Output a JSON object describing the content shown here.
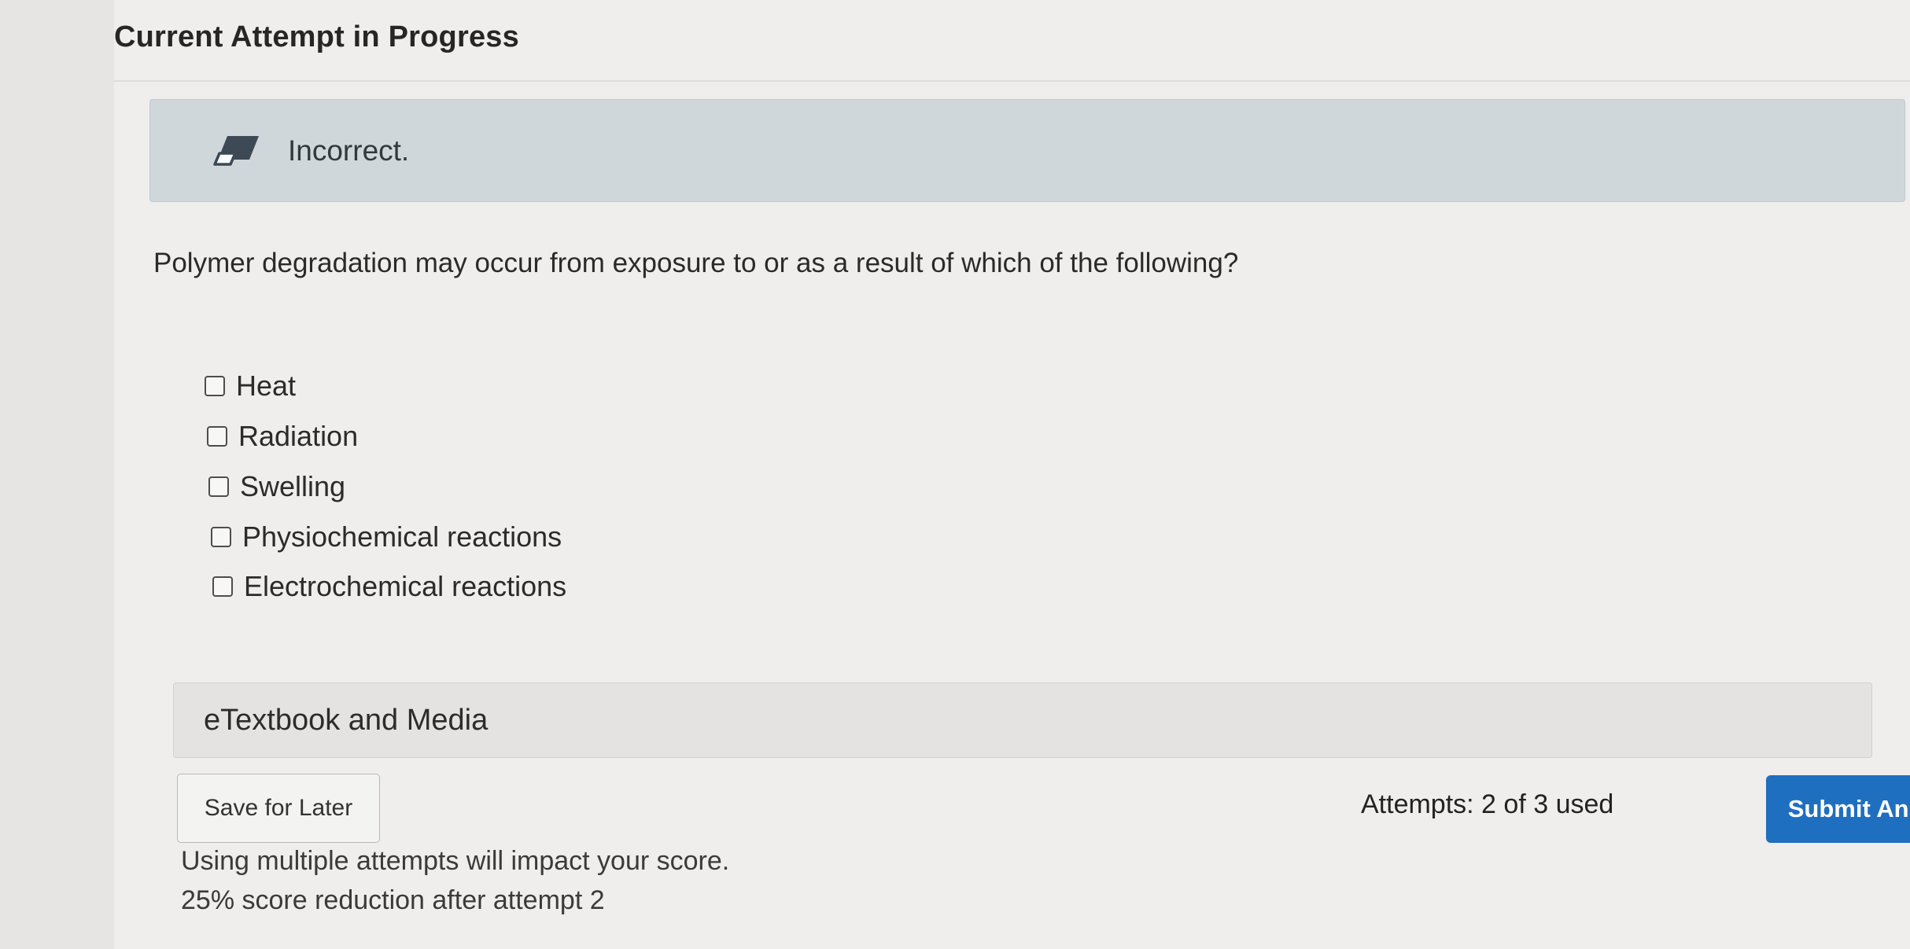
{
  "header": {
    "title": "Current Attempt in Progress"
  },
  "feedback": {
    "icon": "eraser-icon",
    "message": "Incorrect."
  },
  "question": {
    "text": "Polymer degradation may occur from exposure to or as a result of which of the following?",
    "options": [
      {
        "label": "Heat",
        "checked": false
      },
      {
        "label": "Radiation",
        "checked": false
      },
      {
        "label": "Swelling",
        "checked": false
      },
      {
        "label": "Physiochemical reactions",
        "checked": false
      },
      {
        "label": "Electrochemical reactions",
        "checked": false
      }
    ]
  },
  "media": {
    "label": "eTextbook and Media"
  },
  "actions": {
    "save_label": "Save for Later",
    "attempts_text": "Attempts: 2 of 3 used",
    "submit_label": "Submit Answer"
  },
  "warnings": {
    "line1": "Using multiple attempts will impact your score.",
    "line2": "25% score reduction after attempt 2"
  },
  "colors": {
    "banner_bg": "#cfd7db",
    "submit_bg": "#1f6fc0",
    "page_bg": "#efeeec"
  }
}
